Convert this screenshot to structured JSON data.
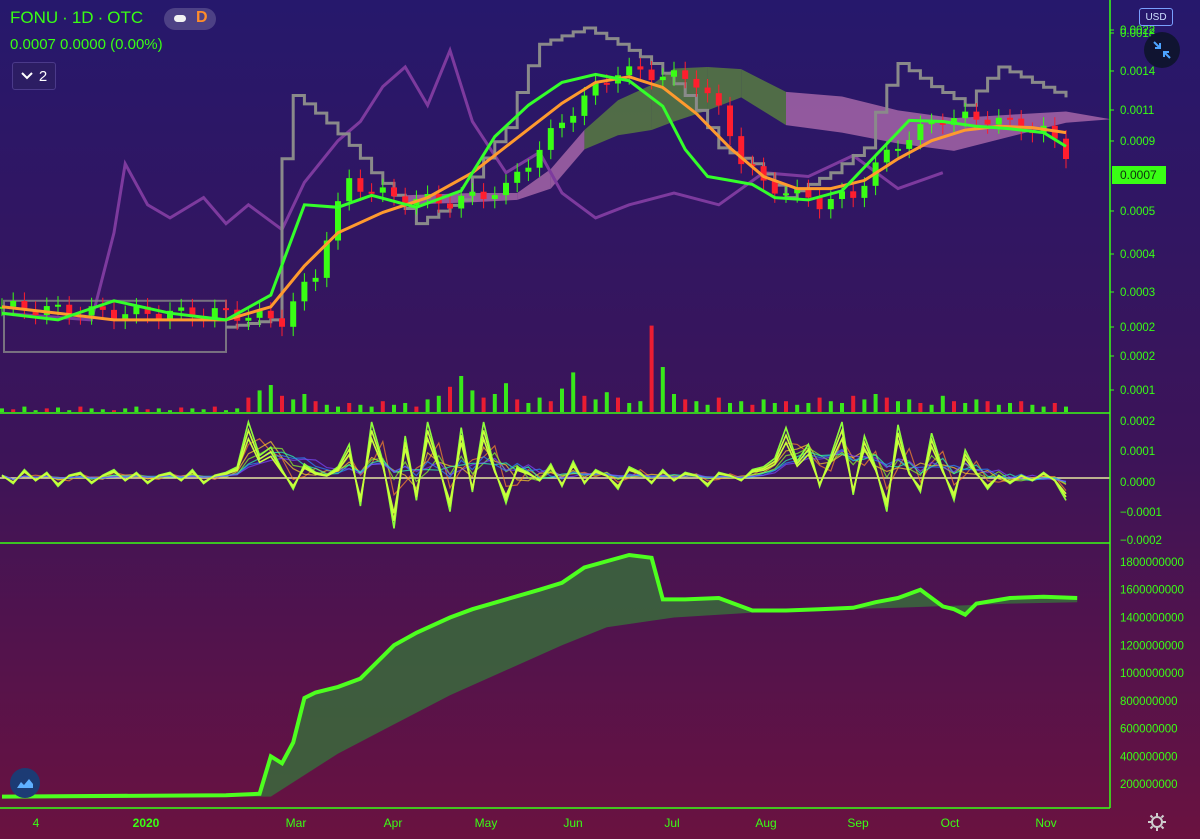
{
  "header": {
    "symbol": "FONU",
    "interval": "1D",
    "exchange": "OTC",
    "interval_badge": "D",
    "price_line": "0.0007  0.0000 (0.00%)",
    "collapse_count": "2",
    "currency": "USD"
  },
  "colors": {
    "bg_top": "#27176b",
    "bg_bottom": "#6a1240",
    "axis_green": "#39ff14",
    "up": "#39ff14",
    "down": "#ff1e2e",
    "ema_fast": "#34ff2a",
    "ema_slow": "#ff9a2e",
    "cloud_bull": "#5e8a3c",
    "cloud_bear": "#b470b0",
    "lagging": "#7d3a9e",
    "envelope": "#8a8a8a",
    "obv_line": "#4dff1f",
    "obv_fill": "#3a6a3c"
  },
  "icons": {
    "collapse": "chevron-down-icon",
    "shrink": "shrink-arrows-icon",
    "logo": "tradingview-cloud-icon",
    "settings": "gear-icon"
  },
  "chart_data": [
    {
      "type": "candlestick",
      "panel": "price",
      "x_labels": [
        "4",
        "2020",
        "Mar",
        "Apr",
        "May",
        "Jun",
        "Jul",
        "Aug",
        "Sep",
        "Oct",
        "Nov"
      ],
      "y_ticks": [
        "0.0022",
        "0.0018",
        "0.0014",
        "0.0011",
        "0.0009",
        "0.0007",
        "0.0005",
        "0.0004",
        "0.0003",
        "0.0002",
        "0.0002",
        "0.0001"
      ],
      "y_scale": "log",
      "last_price": "0.0007",
      "series": [
        {
          "kind": "close",
          "x": [
            0,
            10,
            20,
            25,
            28,
            31,
            35,
            40,
            45,
            48,
            50,
            53,
            55,
            58,
            60,
            62,
            64,
            66,
            68,
            70,
            73,
            76,
            80,
            84,
            88,
            90,
            93,
            95
          ],
          "values": [
            0.00018,
            0.00017,
            0.00017,
            0.00016,
            0.00024,
            0.00055,
            0.00048,
            0.00046,
            0.00052,
            0.00074,
            0.00095,
            0.00128,
            0.0015,
            0.00146,
            0.00142,
            0.00137,
            0.00104,
            0.00068,
            0.00054,
            0.00051,
            0.00046,
            0.00049,
            0.00078,
            0.00098,
            0.00098,
            0.00093,
            0.00087,
            0.00072
          ]
        },
        {
          "kind": "ema_fast",
          "x": [
            0,
            5,
            10,
            15,
            20,
            24,
            27,
            30,
            33,
            37,
            41,
            44,
            47,
            50,
            53,
            56,
            59,
            61,
            63,
            65,
            67,
            69,
            72,
            75,
            78,
            81,
            84,
            87,
            90,
            93,
            95
          ],
          "values": [
            0.00017,
            0.00016,
            0.00019,
            0.00017,
            0.00016,
            0.0002,
            0.00045,
            0.00044,
            0.00049,
            0.00044,
            0.00051,
            0.00083,
            0.0011,
            0.00135,
            0.00145,
            0.00137,
            0.00109,
            0.00074,
            0.00058,
            0.00056,
            0.00054,
            0.00048,
            0.00047,
            0.00051,
            0.0007,
            0.00096,
            0.00095,
            0.00091,
            0.00089,
            0.00086,
            0.00076
          ]
        },
        {
          "kind": "ema_slow",
          "x": [
            0,
            5,
            10,
            15,
            20,
            24,
            27,
            30,
            34,
            38,
            42,
            46,
            50,
            53,
            56,
            59,
            62,
            65,
            68,
            71,
            74,
            77,
            80,
            83,
            86,
            89,
            92,
            95
          ],
          "values": [
            0.00018,
            0.00017,
            0.00016,
            0.00016,
            0.00016,
            0.00018,
            0.00026,
            0.00035,
            0.00042,
            0.00048,
            0.0006,
            0.00082,
            0.00112,
            0.00135,
            0.00142,
            0.00129,
            0.00102,
            0.00075,
            0.00058,
            0.00052,
            0.00052,
            0.00056,
            0.00068,
            0.0008,
            0.00088,
            0.00091,
            0.0009,
            0.00086
          ]
        },
        {
          "kind": "cloud_top",
          "x": [
            36,
            42,
            46,
            49,
            52,
            55,
            58,
            60,
            63,
            66,
            70,
            75,
            80,
            85,
            90,
            95,
            99
          ],
          "values": [
            0.00049,
            0.0005,
            0.0005,
            0.00062,
            0.00088,
            0.00115,
            0.00132,
            0.00153,
            0.00155,
            0.00152,
            0.00124,
            0.00119,
            0.00105,
            0.00098,
            0.00101,
            0.00104,
            0.00097
          ]
        },
        {
          "kind": "cloud_bottom",
          "x": [
            36,
            42,
            46,
            49,
            52,
            55,
            58,
            60,
            63,
            66,
            70,
            75,
            80,
            85,
            90,
            95,
            99
          ],
          "values": [
            0.00045,
            0.00046,
            0.00047,
            0.00052,
            0.00074,
            0.00084,
            0.00088,
            0.00095,
            0.00105,
            0.00118,
            0.00092,
            0.00086,
            0.00078,
            0.00073,
            0.00083,
            0.00094,
            0.00097
          ]
        },
        {
          "kind": "lagging",
          "x": [
            0,
            8,
            10,
            11,
            13,
            15,
            18,
            20,
            22,
            25,
            27,
            30,
            32,
            34,
            36,
            38,
            40,
            42,
            45,
            48,
            50,
            53,
            56,
            60,
            64,
            68,
            72,
            76,
            80,
            84
          ],
          "values": [
            0.00017,
            0.00016,
            0.00035,
            0.00065,
            0.00045,
            0.0004,
            0.00048,
            0.00038,
            0.00045,
            0.00036,
            0.00055,
            0.0008,
            0.00095,
            0.0013,
            0.00155,
            0.0011,
            0.0018,
            0.00095,
            0.0006,
            0.00072,
            0.0005,
            0.0004,
            0.00045,
            0.0005,
            0.00045,
            0.0006,
            0.00058,
            0.0007,
            0.00052,
            0.0006
          ]
        },
        {
          "kind": "envelope",
          "x": [
            20,
            24,
            26,
            30,
            33,
            37,
            41,
            45,
            48,
            52,
            55,
            58,
            61,
            64,
            67,
            70,
            74,
            77,
            80,
            83,
            86,
            89,
            92,
            95
          ],
          "values": [
            0.00015,
            0.00016,
            0.0012,
            0.00085,
            0.0006,
            0.00038,
            0.00047,
            0.0009,
            0.0019,
            0.0022,
            0.0019,
            0.0016,
            0.0012,
            0.00075,
            0.00065,
            0.00048,
            0.0006,
            0.00075,
            0.0016,
            0.0013,
            0.0011,
            0.00155,
            0.00135,
            0.00118
          ]
        }
      ],
      "volume_values": [
        0.2,
        0.15,
        0.3,
        0.1,
        0.2,
        0.25,
        0.1,
        0.3,
        0.2,
        0.15,
        0.1,
        0.2,
        0.3,
        0.15,
        0.2,
        0.1,
        0.25,
        0.2,
        0.15,
        0.3,
        0.1,
        0.2,
        0.8,
        1.2,
        1.5,
        0.9,
        0.7,
        1.0,
        0.6,
        0.4,
        0.3,
        0.5,
        0.4,
        0.3,
        0.6,
        0.4,
        0.5,
        0.3,
        0.7,
        0.9,
        1.4,
        2.0,
        1.2,
        0.8,
        1.0,
        1.6,
        0.7,
        0.5,
        0.8,
        0.6,
        1.3,
        2.2,
        0.9,
        0.7,
        1.1,
        0.8,
        0.5,
        0.6,
        4.8,
        2.5,
        1.0,
        0.7,
        0.6,
        0.4,
        0.8,
        0.5,
        0.6,
        0.4,
        0.7,
        0.5,
        0.6,
        0.4,
        0.5,
        0.8,
        0.6,
        0.5,
        0.9,
        0.7,
        1.0,
        0.8,
        0.6,
        0.7,
        0.5,
        0.4,
        0.9,
        0.6,
        0.5,
        0.7,
        0.6,
        0.4,
        0.5,
        0.6,
        0.4,
        0.3,
        0.5,
        0.3
      ]
    },
    {
      "type": "line",
      "panel": "oscillator",
      "y_ticks": [
        "0.0002",
        "0.0001",
        "0.0000",
        "−0.0001",
        "−0.0002"
      ],
      "ylim": [
        -0.0002,
        0.0002
      ],
      "series": [
        {
          "name": "",
          "values": [
            1e-05,
            -2e-05,
            3e-05,
            -1e-05,
            2e-05,
            -3e-05,
            1e-05,
            2e-05,
            -2e-05,
            1e-05,
            3e-05,
            -1e-05,
            2e-05,
            -2e-05,
            1e-05,
            2e-05,
            -1e-05,
            3e-05,
            -2e-05,
            1e-05,
            2e-05,
            4e-05,
            0.0002,
            8e-05,
            0.00011,
            3e-05,
            -4e-05,
            5e-05,
            2e-05,
            1e-05,
            4e-05,
            0.00012,
            -0.0001,
            0.0002,
            6e-05,
            -0.00018,
            0.00015,
            -8e-05,
            0.0002,
            5e-05,
            -0.00012,
            0.00018,
            -5e-05,
            0.0002,
            3e-05,
            -9e-05,
            4e-05,
            2e-05,
            -1e-05,
            5e-05,
            -3e-05,
            6e-05,
            -2e-05,
            3e-05,
            1e-05,
            -4e-05,
            4e-05,
            2e-05,
            -2e-05,
            3e-05,
            -1e-05,
            2e-05,
            1e-05,
            -3e-05,
            2e-05,
            1e-05,
            -1e-05,
            3e-05,
            4e-05,
            7e-05,
            0.00018,
            6e-05,
            0.00012,
            -3e-05,
            8e-05,
            0.0002,
            -6e-05,
            0.00015,
            4e-05,
            -0.00012,
            0.00019,
            2e-05,
            -5e-05,
            0.00016,
            3e-05,
            -8e-05,
            0.0001,
            2e-05,
            -4e-05,
            1e-05,
            -2e-05,
            1e-05,
            -1e-05,
            2e-05,
            -1e-05,
            -8e-05
          ]
        }
      ]
    },
    {
      "type": "area",
      "panel": "accumulation",
      "y_ticks": [
        "1800000000",
        "1600000000",
        "1400000000",
        "1200000000",
        "1000000000",
        "800000000",
        "600000000",
        "400000000",
        "200000000"
      ],
      "ylim": [
        100000000,
        1850000000
      ],
      "series": [
        {
          "name": "",
          "x": [
            0,
            20,
            23,
            24,
            25,
            26,
            27,
            28,
            30,
            32,
            35,
            37,
            40,
            42,
            45,
            48,
            50,
            52,
            56,
            58,
            59,
            61,
            64,
            67,
            70,
            73,
            76,
            78,
            80,
            82,
            84,
            85,
            86,
            87,
            90,
            93,
            96
          ],
          "values": [
            110000000,
            120000000,
            130000000,
            400000000,
            350000000,
            500000000,
            820000000,
            860000000,
            900000000,
            960000000,
            1200000000,
            1290000000,
            1400000000,
            1460000000,
            1530000000,
            1600000000,
            1650000000,
            1760000000,
            1850000000,
            1830000000,
            1530000000,
            1530000000,
            1540000000,
            1450000000,
            1450000000,
            1460000000,
            1470000000,
            1510000000,
            1540000000,
            1600000000,
            1480000000,
            1460000000,
            1420000000,
            1500000000,
            1540000000,
            1550000000,
            1540000000
          ]
        },
        {
          "name": "",
          "x": [
            0,
            24,
            30,
            40,
            50,
            54,
            60,
            70,
            80,
            90,
            96
          ],
          "values": [
            110000000,
            110000000,
            420000000,
            840000000,
            1200000000,
            1330000000,
            1400000000,
            1450000000,
            1470000000,
            1500000000,
            1510000000
          ]
        }
      ]
    }
  ]
}
